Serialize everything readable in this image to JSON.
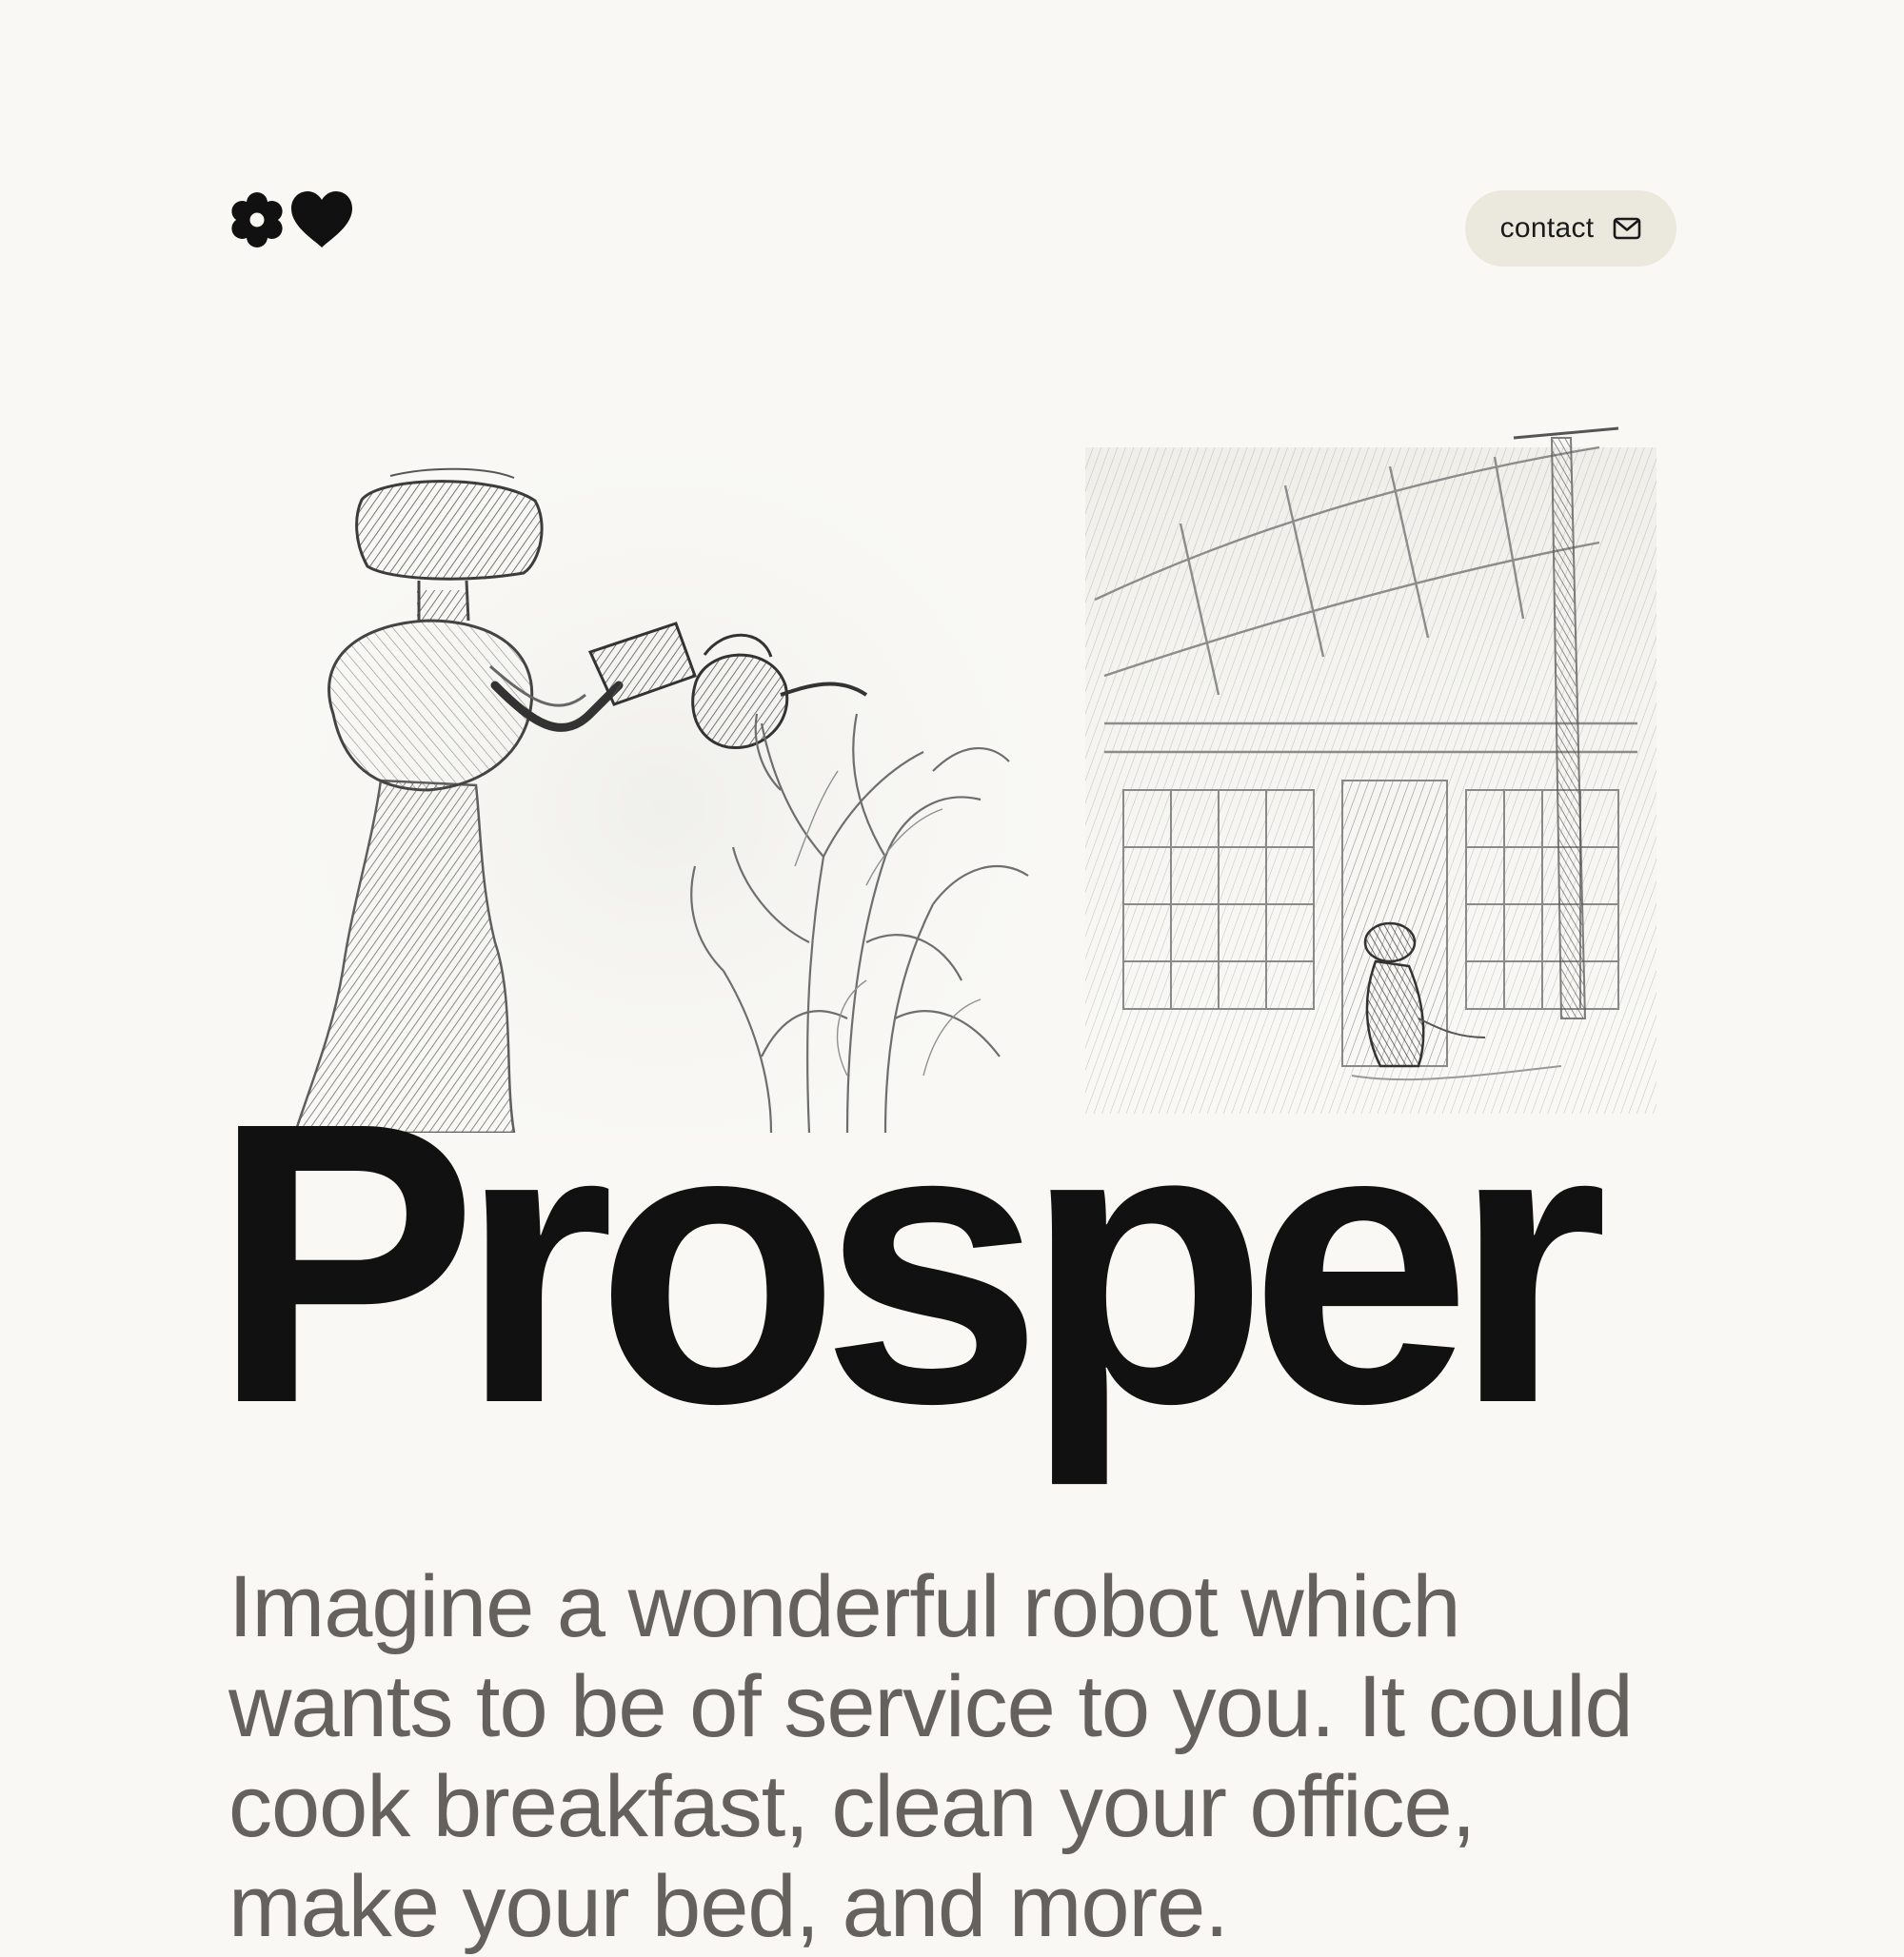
{
  "header": {
    "logo": {
      "icons": [
        "flower-icon",
        "heart-icon"
      ]
    },
    "contact_button": {
      "label": "contact",
      "icon": "mail-icon"
    }
  },
  "hero": {
    "images": [
      "pencil sketch of a robot watering a plant",
      "pencil sketch of a small robot in a greenhouse"
    ],
    "title": "Prosper"
  },
  "intro": {
    "text": "Imagine a wonderful robot which wants to be of service to you. It could cook breakfast, clean your office, make your bed, and more."
  },
  "colors": {
    "background": "#f9f8f4",
    "title": "#111111",
    "body_text": "#65625e",
    "button_bg": "#ebe8dd"
  }
}
